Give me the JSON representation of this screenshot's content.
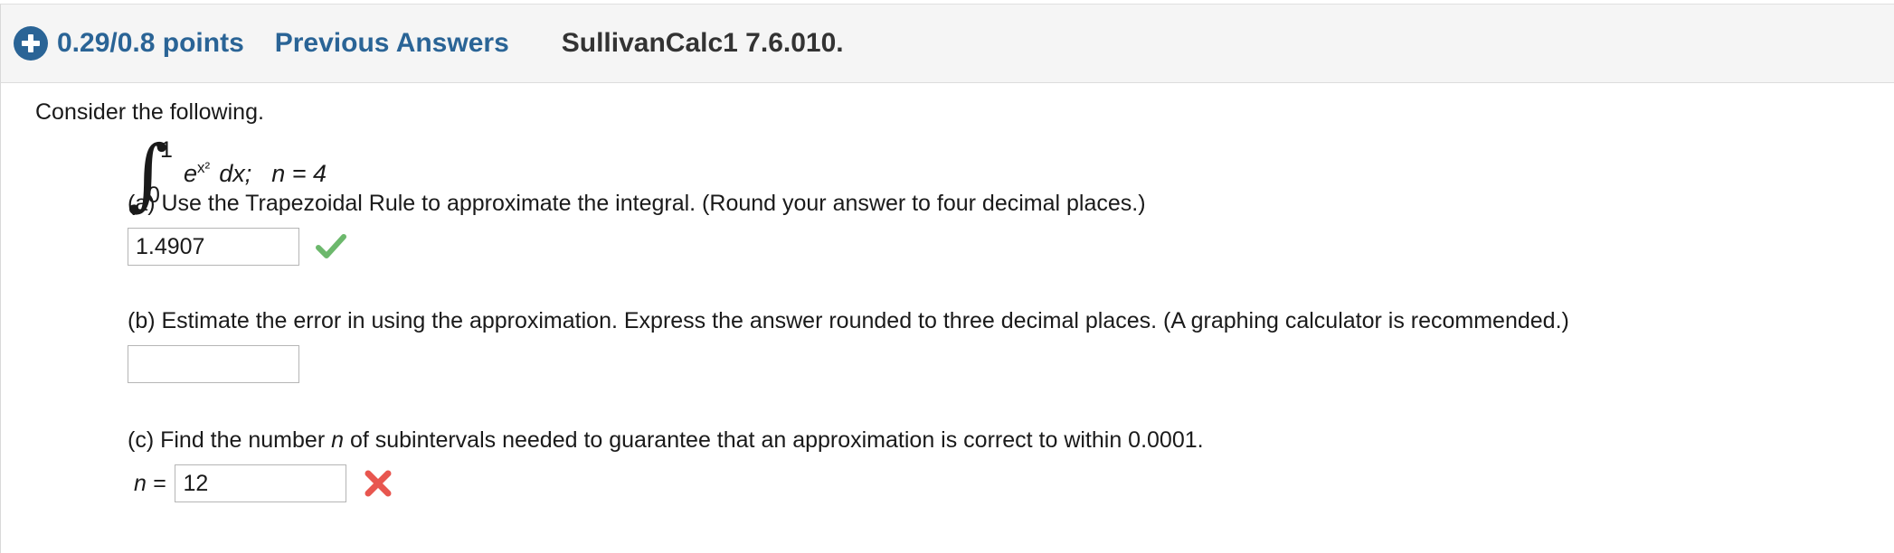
{
  "header": {
    "expand_icon": "plus-circle-icon",
    "points": "0.29/0.8 points",
    "previous_answers_label": "Previous Answers",
    "question_title": "SullivanCalc1 7.6.010.",
    "link_color": "#2a6496",
    "title_color": "#333333",
    "background": "#f5f5f5"
  },
  "body": {
    "intro": "Consider the following.",
    "integral": {
      "sign": "∫",
      "upper_limit": "1",
      "lower_limit": "0",
      "integrand_base": "e",
      "integrand_exponent": "x²",
      "differential": "dx;",
      "condition": "n = 4",
      "plain": "∫₀¹ e^(x²) dx;  n = 4"
    },
    "parts": [
      {
        "id": "a",
        "text": "(a) Use the Trapezoidal Rule to approximate the integral. (Round your answer to four decimal places.)",
        "label": "",
        "value": "1.4907",
        "placeholder": "",
        "status": "correct",
        "status_icon": "green-check-icon",
        "status_color": "#6cb86c"
      },
      {
        "id": "b",
        "text": "(b) Estimate the error in using the approximation. Express the answer rounded to three decimal places. (A graphing calculator is recommended.)",
        "label": "",
        "value": "",
        "placeholder": "",
        "status": "none",
        "status_icon": "",
        "status_color": ""
      },
      {
        "id": "c",
        "text_before": "(c) Find the number ",
        "text_italic": "n",
        "text_after": " of subintervals needed to guarantee that an approximation is correct to within 0.0001.",
        "text": "(c) Find the number n of subintervals needed to guarantee that an approximation is correct to within 0.0001.",
        "label": "n =",
        "value": "12",
        "placeholder": "",
        "status": "incorrect",
        "status_icon": "red-x-icon",
        "status_color": "#e8564f"
      }
    ]
  }
}
